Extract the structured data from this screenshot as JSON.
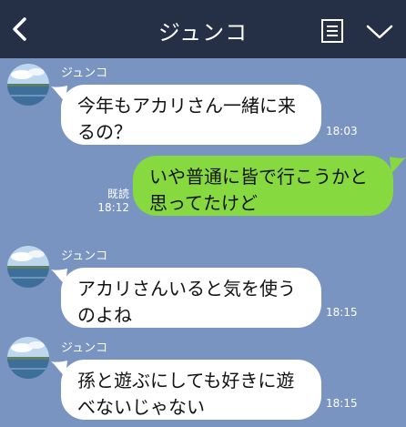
{
  "header": {
    "title": "ジュンコ",
    "icons": [
      "chevron-left-icon",
      "note-icon",
      "chevron-down-icon"
    ],
    "background": "#253047"
  },
  "chat": {
    "background": "#7a94c1",
    "messages": [
      {
        "direction": "incoming",
        "sender": "ジュンコ",
        "lines": [
          "今年もアカリさん一緒に来",
          "るの？"
        ],
        "time": "18:03"
      },
      {
        "direction": "outgoing",
        "lines": [
          "いや普通に皆で行こうかと",
          "思ってたけど"
        ],
        "read": "既読",
        "time": "18:12"
      },
      {
        "direction": "incoming",
        "sender": "ジュンコ",
        "lines": [
          "アカリさんいると気を使う",
          "のよね"
        ],
        "time": "18:15"
      },
      {
        "direction": "incoming",
        "sender": "ジュンコ",
        "lines": [
          "孫と遊ぶにしても好きに遊",
          "べないじゃない"
        ],
        "time": "18:15"
      }
    ]
  }
}
